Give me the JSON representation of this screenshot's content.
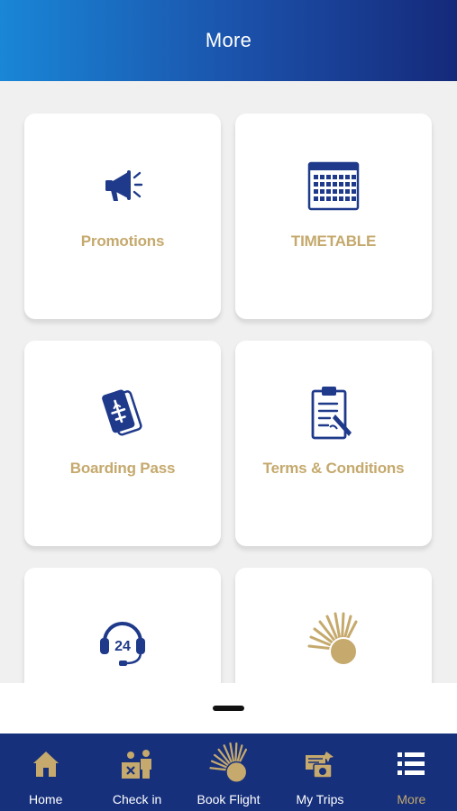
{
  "header": {
    "title": "More"
  },
  "cards": [
    {
      "label": "Promotions",
      "icon": "megaphone-icon"
    },
    {
      "label": "TIMETABLE",
      "icon": "calendar-icon"
    },
    {
      "label": "Boarding Pass",
      "icon": "boarding-pass-icon"
    },
    {
      "label": "Terms & Conditions",
      "icon": "clipboard-icon"
    },
    {
      "label": "",
      "icon": "support-24-headset-icon"
    },
    {
      "label": "",
      "icon": "sunburst-logo-icon"
    }
  ],
  "tabbar": {
    "items": [
      {
        "label": "Home",
        "icon": "home-icon"
      },
      {
        "label": "Check in",
        "icon": "check-in-icon"
      },
      {
        "label": "Book Flight",
        "icon": "sunburst-logo-icon"
      },
      {
        "label": "My Trips",
        "icon": "my-trips-icon"
      },
      {
        "label": "More",
        "icon": "list-icon",
        "active": true
      }
    ]
  },
  "colors": {
    "navy": "#16307c",
    "gold": "#c5a96d",
    "icon_blue": "#1f3a8a"
  }
}
